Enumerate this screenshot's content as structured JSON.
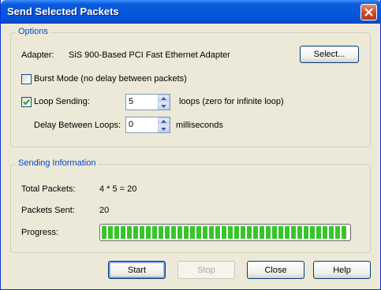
{
  "window": {
    "title": "Send Selected Packets"
  },
  "options": {
    "legend": "Options",
    "adapter_label": "Adapter:",
    "adapter_value": "SiS 900-Based PCI Fast Ethernet Adapter",
    "select_button": "Select...",
    "burst_mode_label": "Burst Mode (no delay between packets)",
    "burst_mode_checked": false,
    "loop_sending_label": "Loop Sending:",
    "loop_sending_checked": true,
    "loop_count": "5",
    "loops_suffix": "loops (zero for infinite loop)",
    "delay_label": "Delay Between Loops:",
    "delay_value": "0",
    "delay_suffix": "milliseconds"
  },
  "sending_info": {
    "legend": "Sending Information",
    "total_packets_label": "Total Packets:",
    "total_packets_value": "4 * 5 = 20",
    "packets_sent_label": "Packets Sent:",
    "packets_sent_value": "20",
    "progress_label": "Progress:",
    "progress_fraction": 1.0
  },
  "buttons": {
    "start": "Start",
    "stop": "Stop",
    "close": "Close",
    "help": "Help"
  },
  "colors": {
    "title_bar": "#0a5bd8",
    "group_legend": "#0046d5",
    "progress_fill": "#37c52a"
  },
  "icons": {
    "close": "close-icon",
    "check": "checkmark-icon",
    "spin_up": "arrow-up-icon",
    "spin_down": "arrow-down-icon"
  }
}
